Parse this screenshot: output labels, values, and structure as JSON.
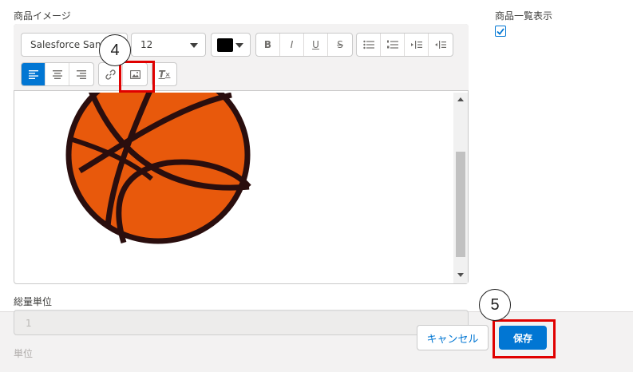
{
  "product_image": {
    "label": "商品イメージ",
    "toolbar": {
      "font_family": "Salesforce Sans",
      "font_size": "12",
      "text_color": "#000000"
    }
  },
  "display_in_list": {
    "label": "商品一覧表示",
    "checked": true
  },
  "total_unit": {
    "label": "総量単位",
    "value": "1"
  },
  "unit": {
    "label": "単位"
  },
  "callouts": {
    "step4": "4",
    "step5": "5"
  },
  "footer": {
    "cancel_label": "キャンセル",
    "save_label": "保存"
  },
  "colors": {
    "brand": "#0176d3",
    "highlight": "#e00000",
    "ball": "#e8590c"
  },
  "icons": [
    "bold-icon",
    "italic-icon",
    "underline-icon",
    "strikethrough-icon",
    "bullet-list-icon",
    "numbered-list-icon",
    "indent-icon",
    "outdent-icon",
    "align-left-icon",
    "align-center-icon",
    "align-right-icon",
    "link-icon",
    "image-icon",
    "clear-formatting-icon",
    "checkmark-icon"
  ]
}
